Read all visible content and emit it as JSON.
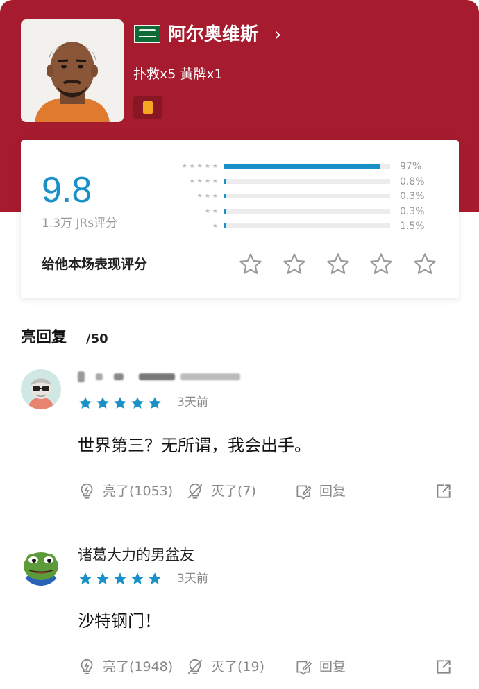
{
  "player": {
    "name": "阿尔奥维斯",
    "chevron": "›",
    "stats": "扑救x5 黄牌x1",
    "flag_icon": "saudi-arabia-flag",
    "card_icon": "yellow-card-icon"
  },
  "rating": {
    "score": "9.8",
    "count_label": "1.3万 JRs评分",
    "distribution": [
      {
        "stars": 5,
        "percent": 97,
        "label": "97%"
      },
      {
        "stars": 4,
        "percent": 0.8,
        "label": "0.8%"
      },
      {
        "stars": 3,
        "percent": 0.3,
        "label": "0.3%"
      },
      {
        "stars": 2,
        "percent": 0.3,
        "label": "0.3%"
      },
      {
        "stars": 1,
        "percent": 1.5,
        "label": "1.5%"
      }
    ],
    "rate_label": "给他本场表现评分"
  },
  "replies": {
    "title": "亮回复",
    "count": "/50"
  },
  "comments": [
    {
      "username": "",
      "username_blurred": true,
      "stars": 5,
      "time": "3天前",
      "text": "世界第三？无所谓，我会出手。",
      "like_label": "亮了(1053)",
      "dislike_label": "灭了(7)",
      "reply_label": "回复"
    },
    {
      "username": "诸葛大力的男盆友",
      "username_blurred": false,
      "stars": 5,
      "time": "3天前",
      "text": "沙特钢门！",
      "like_label": "亮了(1948)",
      "dislike_label": "灭了(19)",
      "reply_label": "回复"
    }
  ],
  "colors": {
    "hero": "#a61b2e",
    "accent": "#1a90c8",
    "star": "#1a90c8",
    "muted": "#888888"
  }
}
